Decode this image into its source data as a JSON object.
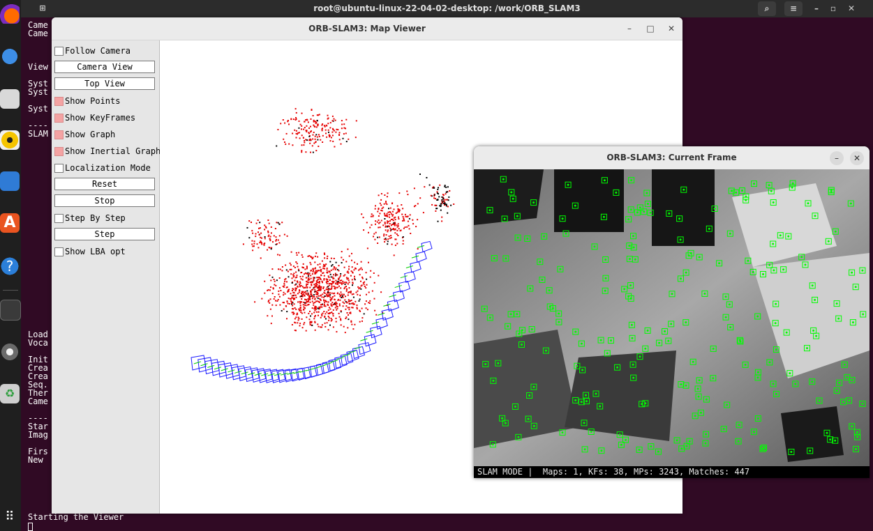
{
  "terminal": {
    "title": "root@ubuntu-linux-22-04-02-desktop: /work/ORB_SLAM3",
    "lines": [
      "Came",
      "Came",
      "",
      "",
      "",
      "View",
      "",
      "Syst",
      "Syst",
      "",
      "Syst",
      "",
      "----",
      "SLAM",
      "",
      "",
      "",
      "",
      "",
      "",
      "",
      "",
      "",
      "",
      "",
      "",
      "",
      "",
      "",
      "",
      "",
      "",
      "",
      "",
      "",
      "",
      "",
      "Load",
      "Voca",
      "",
      "Init",
      "Crea",
      "Crea",
      "Seq.",
      "Ther",
      "Came",
      "",
      "----",
      "Star",
      "Imag",
      "",
      "Firs",
      "New "
    ],
    "last_line": "Starting the Viewer"
  },
  "map_viewer": {
    "title": "ORB-SLAM3: Map Viewer",
    "minimize": "–",
    "maximize": "□",
    "close": "✕",
    "follow_camera": "Follow Camera",
    "camera_view": "Camera View",
    "top_view": "Top View",
    "show_points": "Show Points",
    "show_keyframes": "Show KeyFrames",
    "show_graph": "Show Graph",
    "show_inertial_graph": "Show Inertial Graph",
    "localization_mode": "Localization Mode",
    "reset": "Reset",
    "stop": "Stop",
    "step_by_step": "Step By Step",
    "step": "Step",
    "show_lba_opt": "Show LBA opt"
  },
  "current_frame": {
    "title": "ORB-SLAM3: Current Frame",
    "minimize": "–",
    "close": "✕",
    "status": "SLAM MODE |  Maps: 1, KFs: 38, MPs: 3243, Matches: 447"
  },
  "colors": {
    "map_point": "#e60000",
    "ref_point": "#000000",
    "keyframe": "#1a1aff",
    "graph": "#00cc00",
    "feature": "#00ff00",
    "checked": "#f4a3a3"
  }
}
